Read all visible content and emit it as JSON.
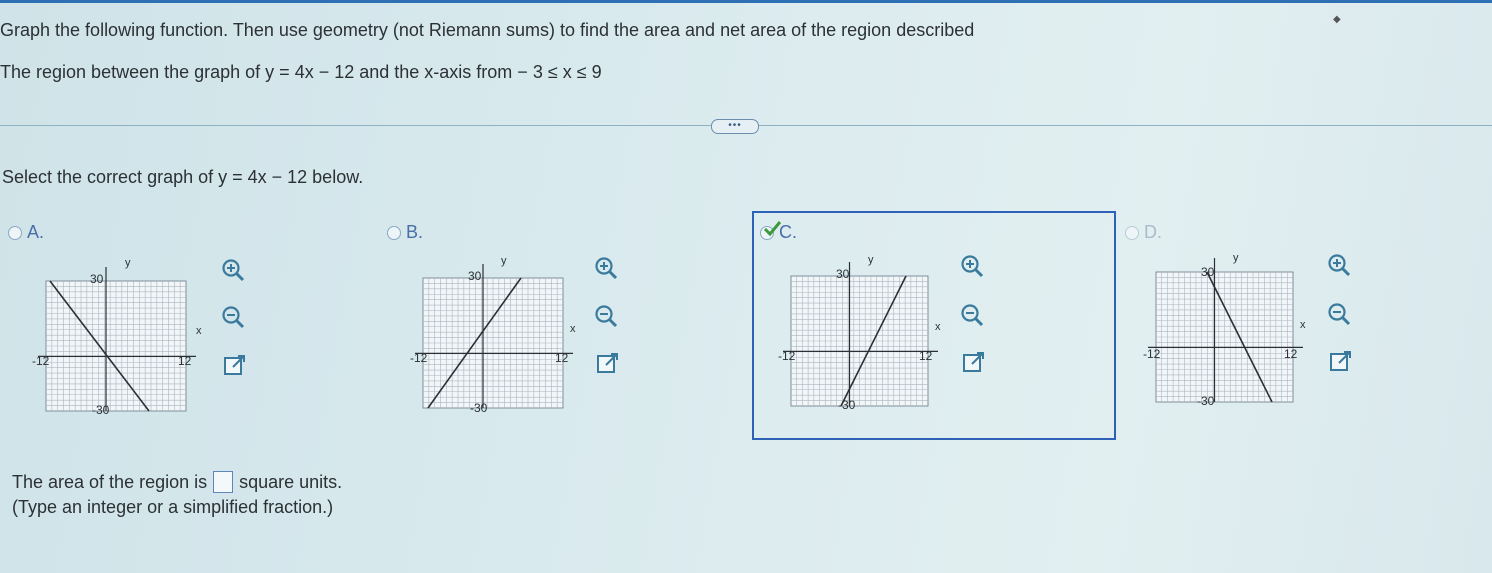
{
  "question": {
    "instruction": "Graph the following function. Then use geometry (not Riemann sums) to find the area and net area of the region described",
    "region": "The region between the graph of y = 4x − 12 and the x-axis from  − 3 ≤ x ≤ 9"
  },
  "more_button": "•••",
  "select_prompt": "Select the correct graph of y = 4x − 12 below.",
  "options": [
    {
      "label": "A.",
      "selected": false,
      "y_max": "30",
      "y_min": "-30",
      "x_min": "-12",
      "x_max": "12",
      "x_axis": "x",
      "y_axis": "y"
    },
    {
      "label": "B.",
      "selected": false,
      "y_max": "30",
      "y_min": "-30",
      "x_min": "-12",
      "x_max": "12",
      "x_axis": "x",
      "y_axis": "y"
    },
    {
      "label": "C.",
      "selected": true,
      "y_max": "30",
      "y_min": "-30",
      "x_min": "-12",
      "x_max": "12",
      "x_axis": "x",
      "y_axis": "y"
    },
    {
      "label": "D.",
      "selected": false,
      "y_max": "30",
      "y_min": "-30",
      "x_min": "-12",
      "x_max": "12",
      "x_axis": "x",
      "y_axis": "y"
    }
  ],
  "answer": {
    "prefix": "The area of the region is",
    "value": "",
    "suffix": "square units.",
    "hint": "(Type an integer or a simplified fraction.)"
  },
  "icons": {
    "zoom_in": "zoom-in-icon",
    "zoom_out": "zoom-out-icon",
    "popout": "popout-icon",
    "check": "checkmark-icon"
  },
  "colors": {
    "accent": "#2d62b8",
    "check": "#3c9a3c",
    "grid_line": "#8a9aa6"
  }
}
